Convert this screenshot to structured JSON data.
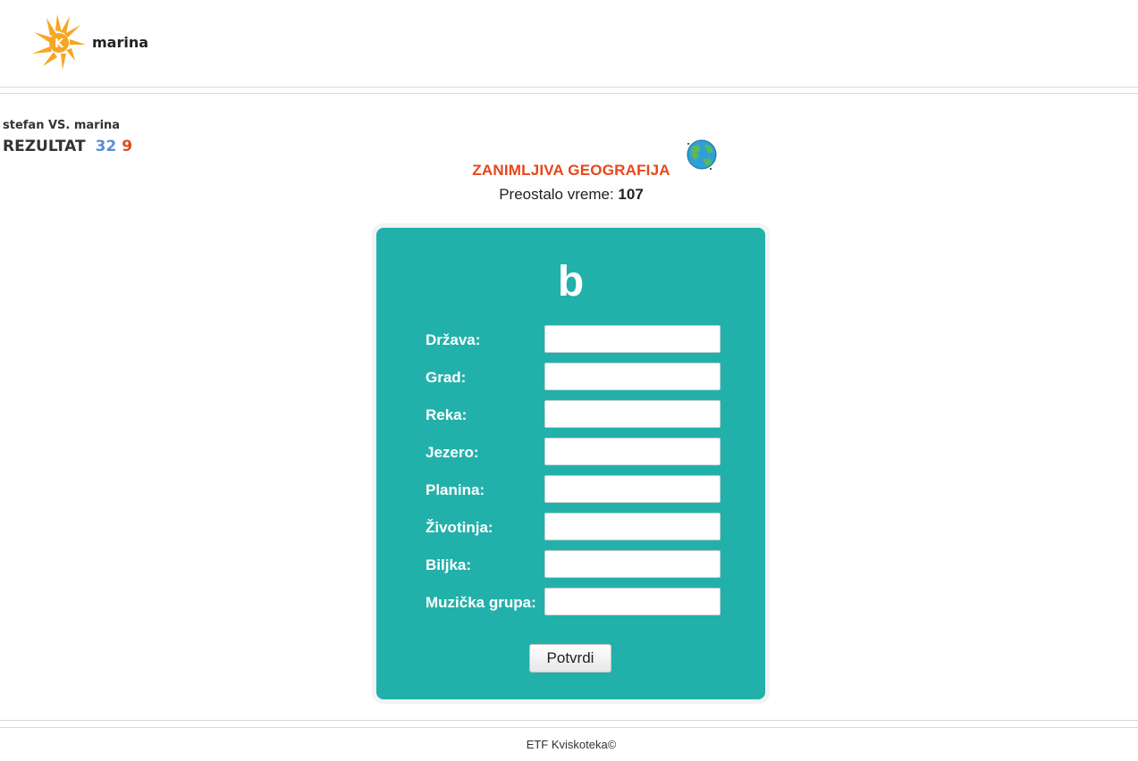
{
  "header": {
    "username": "marina"
  },
  "match": {
    "players": "stefan VS. marina",
    "score_label": "REZULTAT",
    "score_player1": "32",
    "score_player2": "9"
  },
  "game": {
    "title": "ZANIMLJIVA GEOGRAFIJA",
    "timer_label": "Preostalo vreme:",
    "timer_value": "107",
    "letter": "b"
  },
  "form": {
    "fields": [
      {
        "label": "Država:",
        "value": ""
      },
      {
        "label": "Grad:",
        "value": ""
      },
      {
        "label": "Reka:",
        "value": ""
      },
      {
        "label": "Jezero:",
        "value": ""
      },
      {
        "label": "Planina:",
        "value": ""
      },
      {
        "label": "Životinja:",
        "value": ""
      },
      {
        "label": "Biljka:",
        "value": ""
      },
      {
        "label": "Muzička grupa:",
        "value": ""
      }
    ],
    "submit_label": "Potvrdi"
  },
  "footer": {
    "text": "ETF Kviskoteka©"
  },
  "colors": {
    "card": "#22b1aa",
    "title": "#e8461a",
    "score_player1": "#5b8fd6",
    "score_player2": "#e04a1a",
    "logo": "#f5a623"
  },
  "icons": {
    "logo": "lightning-k-logo-icon",
    "globe": "globe-icon"
  }
}
